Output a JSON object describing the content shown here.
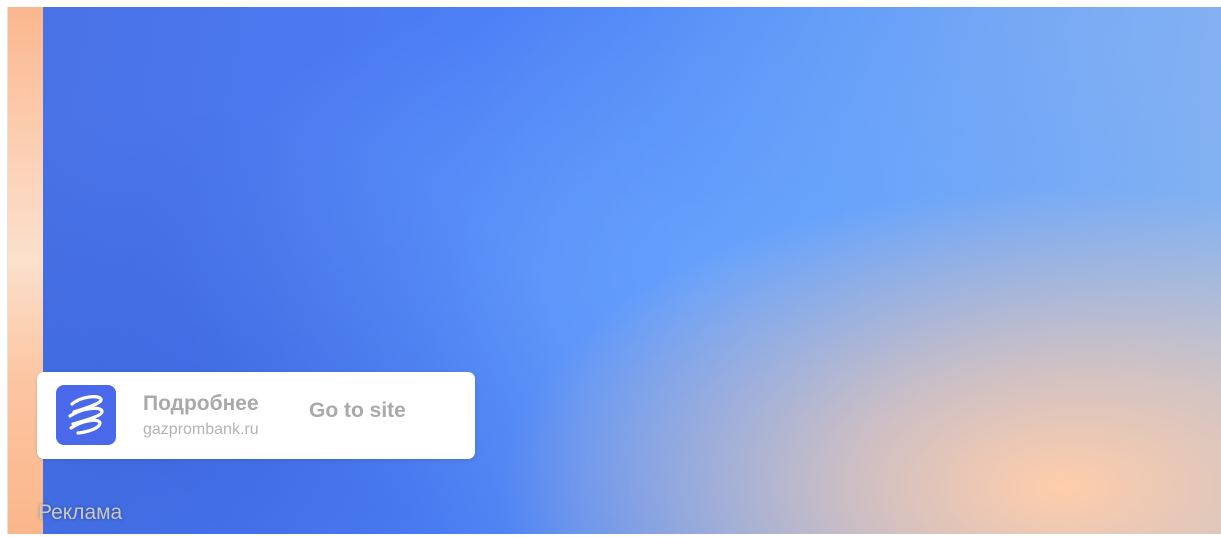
{
  "ad": {
    "title": "Подробнее",
    "domain": "gazprombank.ru",
    "cta_label": "Go to site",
    "logo_icon": "gazprombank-logo-icon",
    "logo_color": "#4a68ea"
  },
  "label": {
    "text": "Реклама"
  }
}
